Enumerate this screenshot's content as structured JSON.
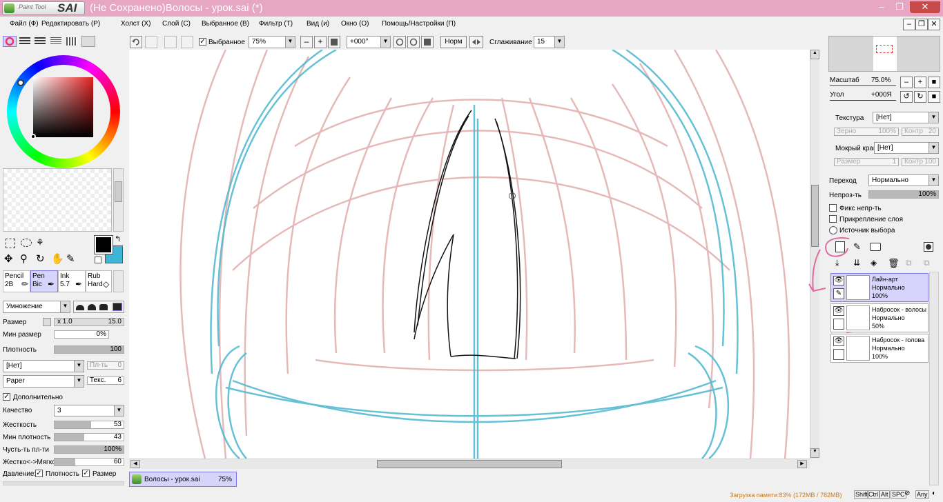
{
  "app": {
    "logo_small": "Paint Tool",
    "logo_big": "SAI",
    "title": "(Не Сохранено)Волосы - урок.sai (*)"
  },
  "menu": [
    "Файл (Ф)",
    "Редактировать (Р)",
    "Холст (Х)",
    "Слой (С)",
    "Выбранное (В)",
    "Фильтр (Т)",
    "Вид (и)",
    "Окно (О)",
    "Помощь/Настройки (П)"
  ],
  "toolbar": {
    "selected_label": "Выбранное",
    "zoom": "75%",
    "angle": "+000°",
    "norm": "Норм",
    "smoothing_label": "Сглаживание",
    "smoothing": "15"
  },
  "colors": {
    "primary": "#000000",
    "secondary": "#40b4d6",
    "accent": "#d6d4fb",
    "titlebar": "#e7a6c3"
  },
  "tools": [
    {
      "name": "Pencil",
      "sub": "2B"
    },
    {
      "name": "Pen",
      "sub": "Bic"
    },
    {
      "name": "Ink",
      "sub": "5.7"
    },
    {
      "name": "Rub",
      "sub": "Hard"
    }
  ],
  "brush": {
    "blend_mode": "Умножение",
    "size_label": "Размер",
    "size_mult": "x 1.0",
    "size_val": "15.0",
    "min_size_label": "Мин размер",
    "min_size_val": "0%",
    "density_label": "Плотность",
    "density_val": "100",
    "texture1": "[Нет]",
    "texture1_label": "Пл-ть",
    "texture1_val": "0",
    "texture2": "Paper",
    "texture2_label": "Текс.",
    "texture2_val": "6",
    "extra_label": "Дополнительно",
    "quality_label": "Качество",
    "quality_val": "3",
    "hardness_label": "Жесткость",
    "hardness_val": "53",
    "min_density_label": "Мин плотность",
    "min_density_val": "43",
    "sensitivity_label": "Чусть-ть пл-ти",
    "sensitivity_val": "100%",
    "hardsoft_label": "Жестко<->Мягко",
    "hardsoft_val": "60",
    "pressure_label": "Давление:",
    "pressure_density": "Плотность",
    "pressure_size": "Размер"
  },
  "navigator": {
    "scale_label": "Масштаб",
    "scale_val": "75.0%",
    "angle_label": "Угол",
    "angle_val": "+000Я"
  },
  "layer_props": {
    "texture_label": "Текстура",
    "texture_val": "[Нет]",
    "grain_label": "Зерно",
    "grain_val": "100%",
    "contrast_label": "Контр",
    "contrast_val": "20",
    "wet_label": "Мокрый край",
    "wet_val": "[Нет]",
    "size_label": "Размер",
    "size_val": "1",
    "contrast2_label": "Контр",
    "contrast2_val": "100",
    "blend_label": "Переход",
    "blend_val": "Нормально",
    "opacity_label": "Непроз-ть",
    "opacity_val": "100%",
    "fix_opacity": "Фикс непр-ть",
    "clip_layer": "Прикрепление слоя",
    "selection_source": "Источник выбора"
  },
  "layers": [
    {
      "name": "Лайн-арт",
      "mode": "Нормально",
      "opacity": "100%",
      "selected": true
    },
    {
      "name": "Набросок - волосы",
      "mode": "Нормально",
      "opacity": "50%",
      "selected": false
    },
    {
      "name": "Набросок - голова",
      "mode": "Нормально",
      "opacity": "100%",
      "selected": false
    }
  ],
  "doc_tab": {
    "name": "Волосы - урок.sai",
    "zoom": "75%"
  },
  "status": {
    "memory": "Загрузка памяти:83% (172MB / 782MB)",
    "keys": [
      "Shift",
      "Ctrl",
      "Alt",
      "SPC",
      "Any"
    ]
  }
}
